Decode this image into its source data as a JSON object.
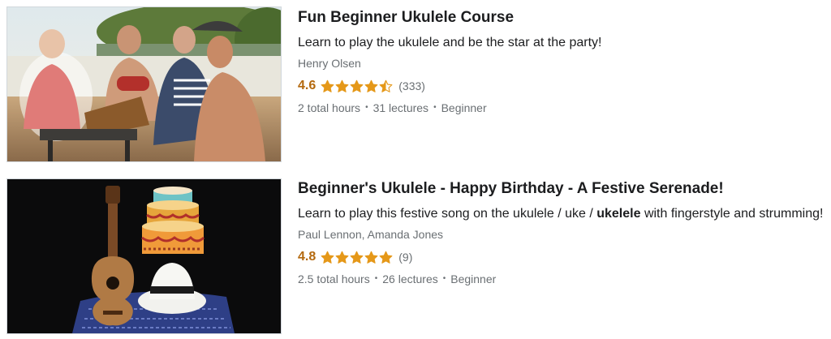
{
  "courses": [
    {
      "title": "Fun Beginner Ukulele Course",
      "headline": "Learn to play the ukulele and be the star at the party!",
      "instructors": "Henry Olsen",
      "rating": "4.6",
      "rating_value": 4.6,
      "review_count": "(333)",
      "hours": "2 total hours",
      "lectures": "31 lectures",
      "level": "Beginner",
      "image": "friends-playing-ukulele-around-campfire-photo"
    },
    {
      "title": "Beginner's Ukulele - Happy Birthday - A Festive Serenade!",
      "headline_pre": "Learn to play this festive song on the ukulele / uke / ",
      "headline_bold": "ukelele",
      "headline_post": " with fingerstyle and strumming!",
      "instructors": "Paul Lennon, Amanda Jones",
      "rating": "4.8",
      "rating_value": 4.8,
      "review_count": "(9)",
      "hours": "2.5 total hours",
      "lectures": "26 lectures",
      "level": "Beginner",
      "image": "ukulele-hat-birthday-cake-photo"
    }
  ],
  "separator": "•",
  "colors": {
    "star": "#e59819",
    "rating_text": "#b4690e",
    "muted_text": "#6a6f73",
    "title_text": "#1c1d1f"
  },
  "icons": {
    "star": "star-icon",
    "half_star": "star-half-icon"
  }
}
